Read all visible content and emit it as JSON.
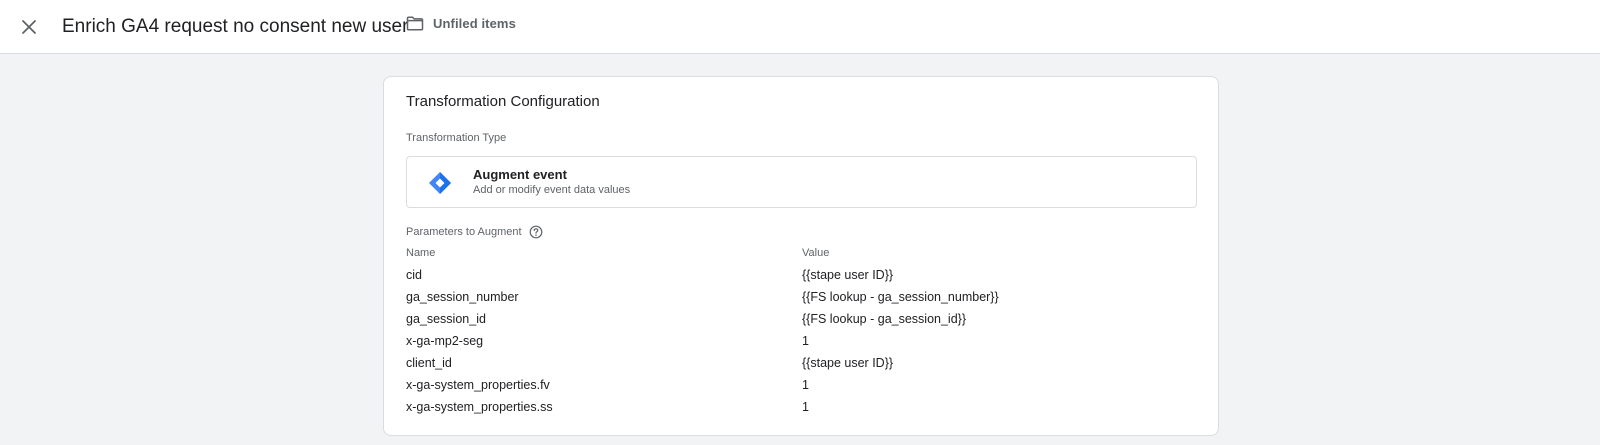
{
  "header": {
    "title": "Enrich GA4 request no consent new user",
    "folder_label": "Unfiled items"
  },
  "card": {
    "title": "Transformation Configuration",
    "transformation_type_label": "Transformation Type",
    "transformation": {
      "name": "Augment event",
      "description": "Add or modify event data values"
    },
    "parameters_label": "Parameters to Augment",
    "columns": {
      "name": "Name",
      "value": "Value"
    },
    "rows": [
      {
        "name": "cid",
        "value": "{{stape user ID}}"
      },
      {
        "name": "ga_session_number",
        "value": "{{FS lookup - ga_session_number}}"
      },
      {
        "name": "ga_session_id",
        "value": "{{FS lookup - ga_session_id}}"
      },
      {
        "name": "x-ga-mp2-seg",
        "value": "1"
      },
      {
        "name": "client_id",
        "value": "{{stape user ID}}"
      },
      {
        "name": "x-ga-system_properties.fv",
        "value": "1"
      },
      {
        "name": "x-ga-system_properties.ss",
        "value": "1"
      }
    ]
  },
  "colors": {
    "accent": "#4285f4",
    "accent_dark": "#1a73e8",
    "background": "#f1f3f4",
    "text_secondary": "#5f6368"
  }
}
